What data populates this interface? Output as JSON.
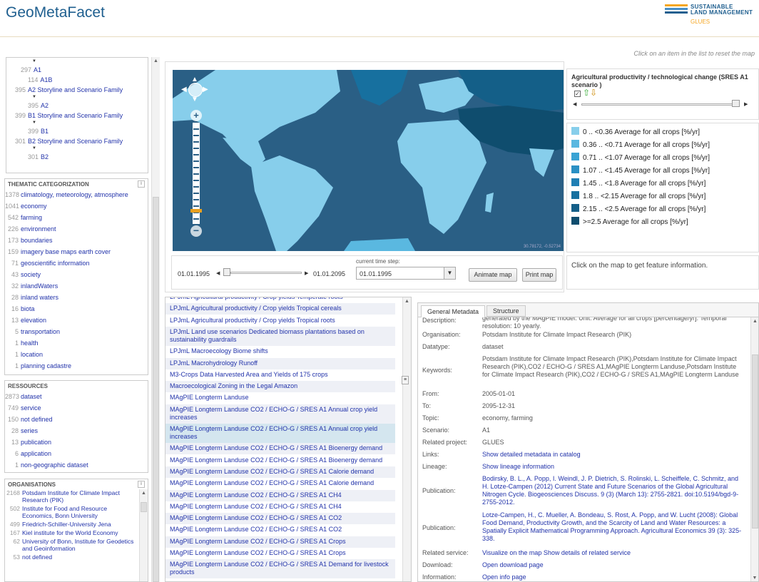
{
  "header": {
    "title": "GeoMetaFacet",
    "logo_line1": "SUSTAINABLE",
    "logo_line2": "LAND MANAGEMENT",
    "logo_line3": "GLUES",
    "hint": "Click on an item in the list to reset the map"
  },
  "scenario_tree": [
    {
      "count": "297",
      "label": "A1",
      "indent": 1
    },
    {
      "count": "114",
      "label": "A1B",
      "indent": 2
    },
    {
      "count": "395",
      "label": "A2 Storyline and Scenario Family",
      "indent": 0
    },
    {
      "count": "395",
      "label": "A2",
      "indent": 2
    },
    {
      "count": "399",
      "label": "B1 Storyline and Scenario Family",
      "indent": 0
    },
    {
      "count": "399",
      "label": "B1",
      "indent": 2
    },
    {
      "count": "301",
      "label": "B2 Storyline and Scenario Family",
      "indent": 0
    },
    {
      "count": "301",
      "label": "B2",
      "indent": 2
    }
  ],
  "thematic": {
    "title": "THEMATIC CATEGORIZATION",
    "items": [
      {
        "count": "1378",
        "label": "climatology, meteorology, atmosphere"
      },
      {
        "count": "1041",
        "label": "economy"
      },
      {
        "count": "542",
        "label": "farming"
      },
      {
        "count": "226",
        "label": "environment"
      },
      {
        "count": "173",
        "label": "boundaries"
      },
      {
        "count": "159",
        "label": "imagery base maps earth cover"
      },
      {
        "count": "71",
        "label": "geoscientific information"
      },
      {
        "count": "43",
        "label": "society"
      },
      {
        "count": "32",
        "label": "inlandWaters"
      },
      {
        "count": "28",
        "label": "inland waters"
      },
      {
        "count": "16",
        "label": "biota"
      },
      {
        "count": "13",
        "label": "elevation"
      },
      {
        "count": "5",
        "label": "transportation"
      },
      {
        "count": "1",
        "label": "health"
      },
      {
        "count": "1",
        "label": "location"
      },
      {
        "count": "1",
        "label": "planning cadastre"
      }
    ]
  },
  "resources": {
    "title": "RESSOURCES",
    "items": [
      {
        "count": "2873",
        "label": "dataset"
      },
      {
        "count": "749",
        "label": "service"
      },
      {
        "count": "150",
        "label": "not defined"
      },
      {
        "count": "28",
        "label": "series"
      },
      {
        "count": "13",
        "label": "publication"
      },
      {
        "count": "6",
        "label": "application"
      },
      {
        "count": "1",
        "label": "non-geographic dataset"
      }
    ]
  },
  "organisations": {
    "title": "ORGANISATIONS",
    "items": [
      {
        "count": "2168",
        "label": "Potsdam Institute for Climate Impact Research (PIK)"
      },
      {
        "count": "502",
        "label": "Institute for Food and Resource Economics, Bonn University"
      },
      {
        "count": "499",
        "label": "Friedrich-Schiller-University Jena"
      },
      {
        "count": "167",
        "label": "Kiel institute for the World Economy"
      },
      {
        "count": "62",
        "label": "University of Bonn, Institute for Geodetics and Geoinformation"
      },
      {
        "count": "53",
        "label": "not defined"
      }
    ]
  },
  "map": {
    "coords": "30.78172, -0.52734",
    "layer_title": "Agricultural productivity / technological change (SRES A1 scenario )",
    "time_label": "current time step:",
    "start_date": "01.01.1995",
    "end_date": "01.01.2095",
    "current_step": "01.01.1995",
    "animate_btn": "Animate map",
    "print_btn": "Print map",
    "feature_info": "Click on the map to get feature information."
  },
  "legend": [
    {
      "color": "#87ceeb",
      "label": "0 .. <0.36 Average for all crops [%/yr]"
    },
    {
      "color": "#5ab8e0",
      "label": "0.36 .. <0.71 Average for all crops [%/yr]"
    },
    {
      "color": "#3aa3d4",
      "label": "0.71 .. <1.07 Average for all crops [%/yr]"
    },
    {
      "color": "#2a90c4",
      "label": "1.07 .. <1.45 Average for all crops [%/yr]"
    },
    {
      "color": "#1f7fb4",
      "label": "1.45 .. <1.8 Average for all crops [%/yr]"
    },
    {
      "color": "#17709f",
      "label": "1.8 .. <2.15 Average for all crops [%/yr]"
    },
    {
      "color": "#145f88",
      "label": "2.15 .. <2.5 Average for all crops [%/yr]"
    },
    {
      "color": "#0f4d6e",
      "label": ">=2.5 Average for all crops [%/yr]"
    }
  ],
  "results": [
    "LPJmL Agricultural productivity / Crop yields Temperate roots",
    "LPJmL Agricultural productivity / Crop yields Tropical cereals",
    "LPJmL Agricultural productivity / Crop yields Tropical roots",
    "LPJmL Land use scenarios Dedicated biomass plantations based on sustainability guardrails",
    "LPJmL Macroecology Biome shifts",
    "LPJmL Macrohydrology Runoff",
    "M3-Crops Data Harvested Area and Yields of 175 crops",
    "Macroecological Zoning in the Legal Amazon",
    "MAgPIE Longterm Landuse",
    "MAgPIE Longterm Landuse CO2 / ECHO-G / SRES A1 Annual crop yield increases",
    "MAgPIE Longterm Landuse CO2 / ECHO-G / SRES A1 Annual crop yield increases",
    "MAgPIE Longterm Landuse CO2 / ECHO-G / SRES A1 Bioenergy demand",
    "MAgPIE Longterm Landuse CO2 / ECHO-G / SRES A1 Bioenergy demand",
    "MAgPIE Longterm Landuse CO2 / ECHO-G / SRES A1 Calorie demand",
    "MAgPIE Longterm Landuse CO2 / ECHO-G / SRES A1 Calorie demand",
    "MAgPIE Longterm Landuse CO2 / ECHO-G / SRES A1 CH4",
    "MAgPIE Longterm Landuse CO2 / ECHO-G / SRES A1 CH4",
    "MAgPIE Longterm Landuse CO2 / ECHO-G / SRES A1 CO2",
    "MAgPIE Longterm Landuse CO2 / ECHO-G / SRES A1 CO2",
    "MAgPIE Longterm Landuse CO2 / ECHO-G / SRES A1 Crops",
    "MAgPIE Longterm Landuse CO2 / ECHO-G / SRES A1 Crops",
    "MAgPIE Longterm Landuse CO2 / ECHO-G / SRES A1 Demand for livestock products"
  ],
  "tabs": {
    "general": "General Metadata",
    "structure": "Structure"
  },
  "metadata": [
    {
      "k": "Description:",
      "v": "generated by the MAgPIE model. Unit: Average for all crops [percentage/yr]. Temporal resolution: 10 yearly.",
      "link": false,
      "h": 22
    },
    {
      "k": "Organisation:",
      "v": "Potsdam Institute for Climate Impact Research (PIK)",
      "link": false,
      "h": 16
    },
    {
      "k": "Datatype:",
      "v": "dataset",
      "link": false,
      "h": 16
    },
    {
      "k": "Keywords:",
      "v": "Potsdam Institute for Climate Impact Research (PIK),Potsdam Institute for Climate Impact Research (PIK),CO2 / ECHO-G / SRES A1,MAgPIE Longterm Landuse,Potsdam Institute for Climate Impact Research (PIK),CO2 / ECHO-G / SRES A1,MAgPIE Longterm Landuse",
      "link": false,
      "h": 48
    },
    {
      "k": "From:",
      "v": "2005-01-01",
      "link": false,
      "h": 16
    },
    {
      "k": "To:",
      "v": "2095-12-31",
      "link": false,
      "h": 16
    },
    {
      "k": "Topic:",
      "v": "economy, farming",
      "link": false,
      "h": 16
    },
    {
      "k": "Scenario:",
      "v": "A1",
      "link": false,
      "h": 16
    },
    {
      "k": "Related project:",
      "v": "GLUES",
      "link": false,
      "h": 16
    },
    {
      "k": "Links:",
      "v": "Show detailed metadata in catalog",
      "link": true,
      "h": 16
    },
    {
      "k": "Lineage:",
      "v": "Show lineage information",
      "link": true,
      "h": 16
    },
    {
      "k": "Publication:",
      "v": "Bodirsky, B. L., A. Popp, I. Weindl, J. P. Dietrich, S. Rolinski, L. Scheiffele, C. Schmitz, and H. Lotze-Campen (2012) Current State and Future Scenarios of the Global Agricultural Nitrogen Cycle. Biogeosciences Discuss. 9 (3) (March 13): 2755-2821. doi:10.5194/bgd-9-2755-2012.",
      "link": true,
      "h": 50
    },
    {
      "k": "Publication:",
      "v": "Lotze-Campen, H., C. Mueller, A. Bondeau, S. Rost, A. Popp, and W. Lucht (2008): Global Food Demand, Productivity Growth, and the Scarcity of Land and Water Resources: a Spatially Explicit Mathematical Programming Approach. Agricultural Economics 39 (3): 325-338.",
      "link": true,
      "h": 52
    },
    {
      "k": "Related service:",
      "v": "Visualize on the map    Show details of related service",
      "link": true,
      "h": 16
    },
    {
      "k": "Download:",
      "v": "Open download page",
      "link": true,
      "h": 16
    },
    {
      "k": "Information:",
      "v": "Open info page",
      "link": true,
      "h": 16
    }
  ]
}
